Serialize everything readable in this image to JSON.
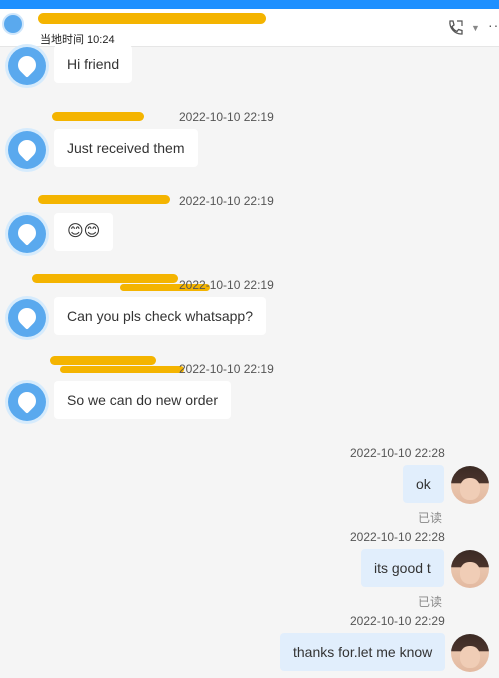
{
  "header": {
    "local_time": "当地时间 10:24"
  },
  "messages_in": [
    {
      "text": "Hi friend",
      "time": ""
    },
    {
      "text": "Just received them",
      "time": "2022-10-10 22:19"
    },
    {
      "text": "😊😊",
      "time": "2022-10-10 22:19"
    },
    {
      "text": "Can you pls check whatsapp?",
      "time": "2022-10-10 22:19"
    },
    {
      "text": "So we can do new order",
      "time": "2022-10-10 22:19"
    }
  ],
  "messages_out": [
    {
      "text": "ok",
      "time": "2022-10-10 22:28",
      "status": "已读"
    },
    {
      "text": "its good t",
      "time": "2022-10-10 22:28",
      "status": "已读"
    },
    {
      "text": "thanks for.let me know",
      "time": "2022-10-10 22:29"
    }
  ],
  "colors": {
    "accent": "#1e90ff",
    "redaction": "#f4b400",
    "my_bubble": "#e1eefc"
  },
  "icons": [
    "contact-avatar",
    "phone-call-icon",
    "more-icon"
  ]
}
